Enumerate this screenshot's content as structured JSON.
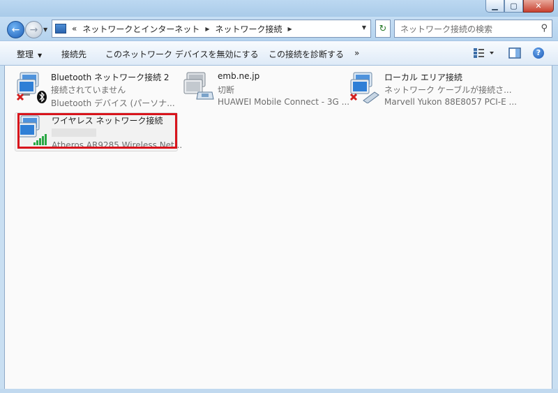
{
  "window": {
    "minimize": "▁",
    "maximize": "▢",
    "close": "✕"
  },
  "nav": {
    "back_glyph": "←",
    "forward_glyph": "→",
    "address": {
      "prefix": "«",
      "segments": [
        "ネットワークとインターネット",
        "ネットワーク接続"
      ],
      "separator": "▶"
    },
    "search_placeholder": "ネットワーク接続の検索",
    "refresh_glyph": "↻",
    "search_glyph": "⚲"
  },
  "toolbar": {
    "organize": "整理",
    "connect_to": "接続先",
    "disable": "このネットワーク デバイスを無効にする",
    "diagnose": "この接続を診断する",
    "more": "»",
    "dropdown_glyph": "▼",
    "help_glyph": "?"
  },
  "connections": [
    {
      "name": "Bluetooth ネットワーク接続 2",
      "status": "接続されていません",
      "device": "Bluetooth デバイス (パーソナ...",
      "icon": "bluetooth-network-icon",
      "disabled": true
    },
    {
      "name": "emb.ne.jp",
      "status": "切断",
      "device": "HUAWEI Mobile Connect - 3G ...",
      "icon": "modem-network-icon",
      "disabled": false
    },
    {
      "name": "ローカル エリア接続",
      "status": "ネットワーク ケーブルが接続さ...",
      "device": "Marvell Yukon 88E8057 PCI-E ...",
      "icon": "lan-network-icon",
      "disabled": true
    },
    {
      "name": "ワイヤレス ネットワーク接続",
      "status": "",
      "device": "Atheros AR9285 Wireless Net...",
      "icon": "wireless-network-icon",
      "disabled": false,
      "selected": true
    }
  ],
  "colors": {
    "highlight": "#d8141c",
    "accent": "#1f5fb7"
  }
}
